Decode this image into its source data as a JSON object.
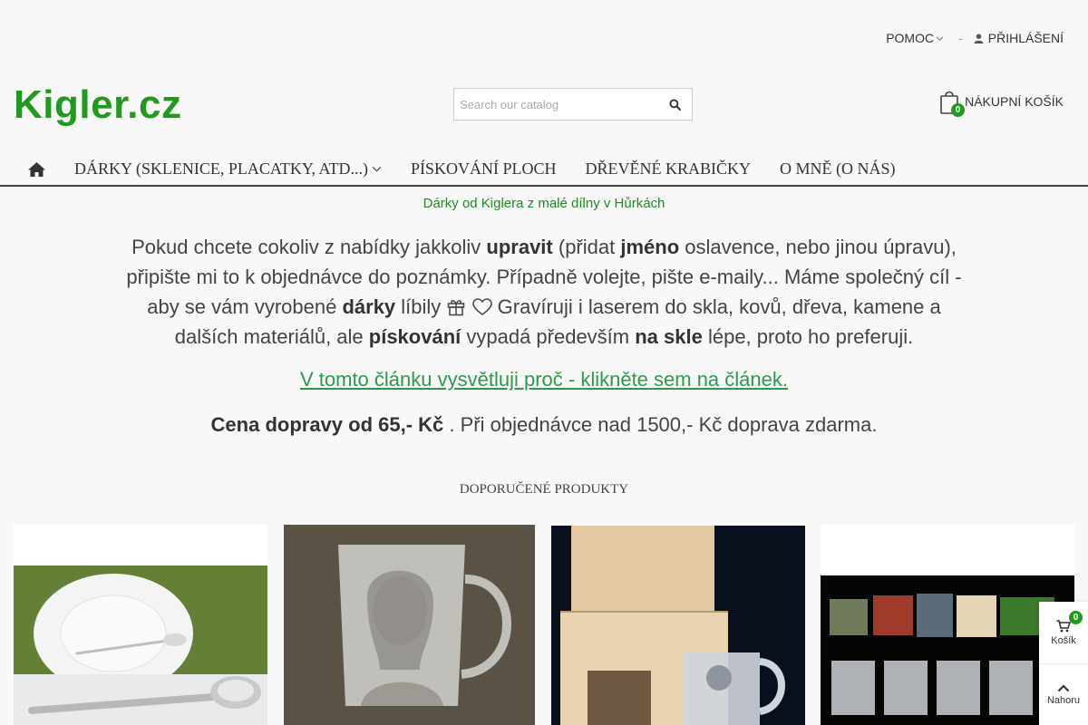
{
  "topbar": {
    "help_label": "POMOC",
    "separator": "-",
    "login_label": "PŘIHLÁŠENÍ"
  },
  "header": {
    "logo_text": "Kigler.cz",
    "search_placeholder": "Search our catalog",
    "cart_label": "NÁKUPNÍ KOŠÍK",
    "cart_count": "0"
  },
  "nav": {
    "items": [
      {
        "label": "DÁRKY (SKLENICE, PLACATKY, ATD...)"
      },
      {
        "label": "PÍSKOVÁNÍ PLOCH"
      },
      {
        "label": "DŘEVĚNÉ KRABIČKY"
      },
      {
        "label": "O MNĚ (O NÁS)"
      }
    ]
  },
  "tagline": "Dárky od Kiglera z malé dílny v Hůrkách",
  "intro": {
    "p1": "Pokud chcete cokoliv z nabídky jakkoliv ",
    "b1": "upravit",
    "p2": " (přidat ",
    "b2": "jméno",
    "p3": " oslavence, nebo jinou úpravu), připište mi to k objednávce do poznámky. Případně volejte, pište e-maily... Máme společný cíl - aby se vám vyrobené ",
    "b3": "dárky",
    "p4": " líbily ",
    "p5": " Gravíruji i laserem do skla, kovů, dřeva, kamene a dalších materiálů, ale ",
    "b4": "pískování",
    "p6": " vypadá především ",
    "b5": "na skle",
    "p7": " lépe, proto ho preferuji."
  },
  "article_link": "V tomto článku vysvětluji proč - klikněte sem na článek.",
  "shipping": {
    "bold": "Cena dopravy od 65,- Kč",
    "rest": " . Při objednávce nad 1500,- Kč doprava zdarma."
  },
  "featured_title": "DOPORUČENÉ PRODUKTY",
  "side_widget": {
    "cart_label": "Košík",
    "cart_count": "0",
    "top_label": "Nahoru"
  },
  "colors": {
    "brand_green": "#1f9a1f",
    "link_green": "#2c9a4a"
  }
}
